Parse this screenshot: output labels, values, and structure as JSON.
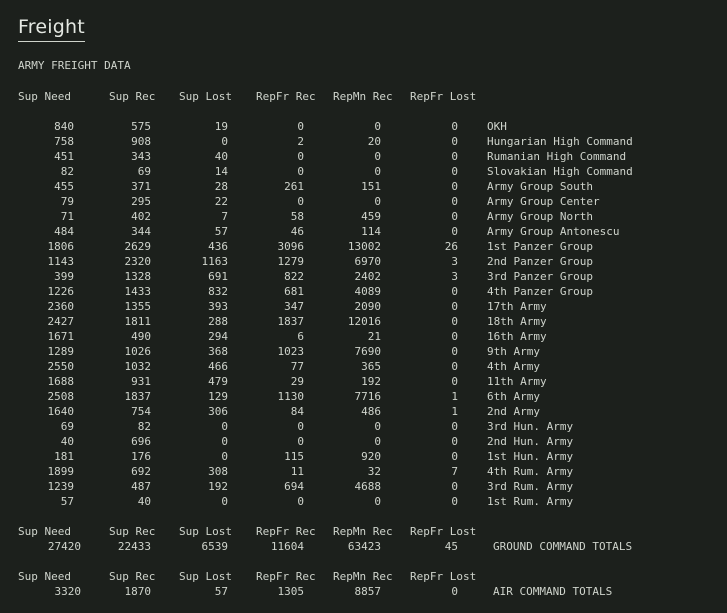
{
  "title": "Freight",
  "subtitle": "ARMY FREIGHT DATA",
  "headers": [
    "Sup Need",
    "Sup Rec",
    "Sup Lost",
    "RepFr Rec",
    "RepMn Rec",
    "RepFr Lost"
  ],
  "rows": [
    {
      "need": "840",
      "rec": "575",
      "lost": "19",
      "rfrec": "0",
      "rmrec": "0",
      "rflost": "0",
      "name": "OKH"
    },
    {
      "need": "758",
      "rec": "908",
      "lost": "0",
      "rfrec": "2",
      "rmrec": "20",
      "rflost": "0",
      "name": "Hungarian High Command"
    },
    {
      "need": "451",
      "rec": "343",
      "lost": "40",
      "rfrec": "0",
      "rmrec": "0",
      "rflost": "0",
      "name": "Rumanian High Command"
    },
    {
      "need": "82",
      "rec": "69",
      "lost": "14",
      "rfrec": "0",
      "rmrec": "0",
      "rflost": "0",
      "name": "Slovakian High Command"
    },
    {
      "need": "455",
      "rec": "371",
      "lost": "28",
      "rfrec": "261",
      "rmrec": "151",
      "rflost": "0",
      "name": "Army Group South"
    },
    {
      "need": "79",
      "rec": "295",
      "lost": "22",
      "rfrec": "0",
      "rmrec": "0",
      "rflost": "0",
      "name": "Army Group Center"
    },
    {
      "need": "71",
      "rec": "402",
      "lost": "7",
      "rfrec": "58",
      "rmrec": "459",
      "rflost": "0",
      "name": "Army Group North"
    },
    {
      "need": "484",
      "rec": "344",
      "lost": "57",
      "rfrec": "46",
      "rmrec": "114",
      "rflost": "0",
      "name": "Army Group Antonescu"
    },
    {
      "need": "1806",
      "rec": "2629",
      "lost": "436",
      "rfrec": "3096",
      "rmrec": "13002",
      "rflost": "26",
      "name": "1st Panzer Group"
    },
    {
      "need": "1143",
      "rec": "2320",
      "lost": "1163",
      "rfrec": "1279",
      "rmrec": "6970",
      "rflost": "3",
      "name": "2nd Panzer Group"
    },
    {
      "need": "399",
      "rec": "1328",
      "lost": "691",
      "rfrec": "822",
      "rmrec": "2402",
      "rflost": "3",
      "name": "3rd Panzer Group"
    },
    {
      "need": "1226",
      "rec": "1433",
      "lost": "832",
      "rfrec": "681",
      "rmrec": "4089",
      "rflost": "0",
      "name": "4th Panzer Group"
    },
    {
      "need": "2360",
      "rec": "1355",
      "lost": "393",
      "rfrec": "347",
      "rmrec": "2090",
      "rflost": "0",
      "name": "17th Army"
    },
    {
      "need": "2427",
      "rec": "1811",
      "lost": "288",
      "rfrec": "1837",
      "rmrec": "12016",
      "rflost": "0",
      "name": "18th Army"
    },
    {
      "need": "1671",
      "rec": "490",
      "lost": "294",
      "rfrec": "6",
      "rmrec": "21",
      "rflost": "0",
      "name": "16th Army"
    },
    {
      "need": "1289",
      "rec": "1026",
      "lost": "368",
      "rfrec": "1023",
      "rmrec": "7690",
      "rflost": "0",
      "name": "9th Army"
    },
    {
      "need": "2550",
      "rec": "1032",
      "lost": "466",
      "rfrec": "77",
      "rmrec": "365",
      "rflost": "0",
      "name": "4th Army"
    },
    {
      "need": "1688",
      "rec": "931",
      "lost": "479",
      "rfrec": "29",
      "rmrec": "192",
      "rflost": "0",
      "name": "11th Army"
    },
    {
      "need": "2508",
      "rec": "1837",
      "lost": "129",
      "rfrec": "1130",
      "rmrec": "7716",
      "rflost": "1",
      "name": "6th Army"
    },
    {
      "need": "1640",
      "rec": "754",
      "lost": "306",
      "rfrec": "84",
      "rmrec": "486",
      "rflost": "1",
      "name": "2nd Army"
    },
    {
      "need": "69",
      "rec": "82",
      "lost": "0",
      "rfrec": "0",
      "rmrec": "0",
      "rflost": "0",
      "name": "3rd Hun. Army"
    },
    {
      "need": "40",
      "rec": "696",
      "lost": "0",
      "rfrec": "0",
      "rmrec": "0",
      "rflost": "0",
      "name": "2nd Hun. Army"
    },
    {
      "need": "181",
      "rec": "176",
      "lost": "0",
      "rfrec": "115",
      "rmrec": "920",
      "rflost": "0",
      "name": "1st Hun. Army"
    },
    {
      "need": "1899",
      "rec": "692",
      "lost": "308",
      "rfrec": "11",
      "rmrec": "32",
      "rflost": "7",
      "name": "4th Rum. Army"
    },
    {
      "need": "1239",
      "rec": "487",
      "lost": "192",
      "rfrec": "694",
      "rmrec": "4688",
      "rflost": "0",
      "name": "3rd Rum. Army"
    },
    {
      "need": "57",
      "rec": "40",
      "lost": "0",
      "rfrec": "0",
      "rmrec": "0",
      "rflost": "0",
      "name": "1st Rum. Army"
    }
  ],
  "ground_totals": {
    "need": "27420",
    "rec": "22433",
    "lost": "6539",
    "rfrec": "11604",
    "rmrec": "63423",
    "rflost": "45",
    "name": "GROUND COMMAND TOTALS"
  },
  "air_totals": {
    "need": "3320",
    "rec": "1870",
    "lost": "57",
    "rfrec": "1305",
    "rmrec": "8857",
    "rflost": "0",
    "name": "AIR COMMAND TOTALS"
  }
}
